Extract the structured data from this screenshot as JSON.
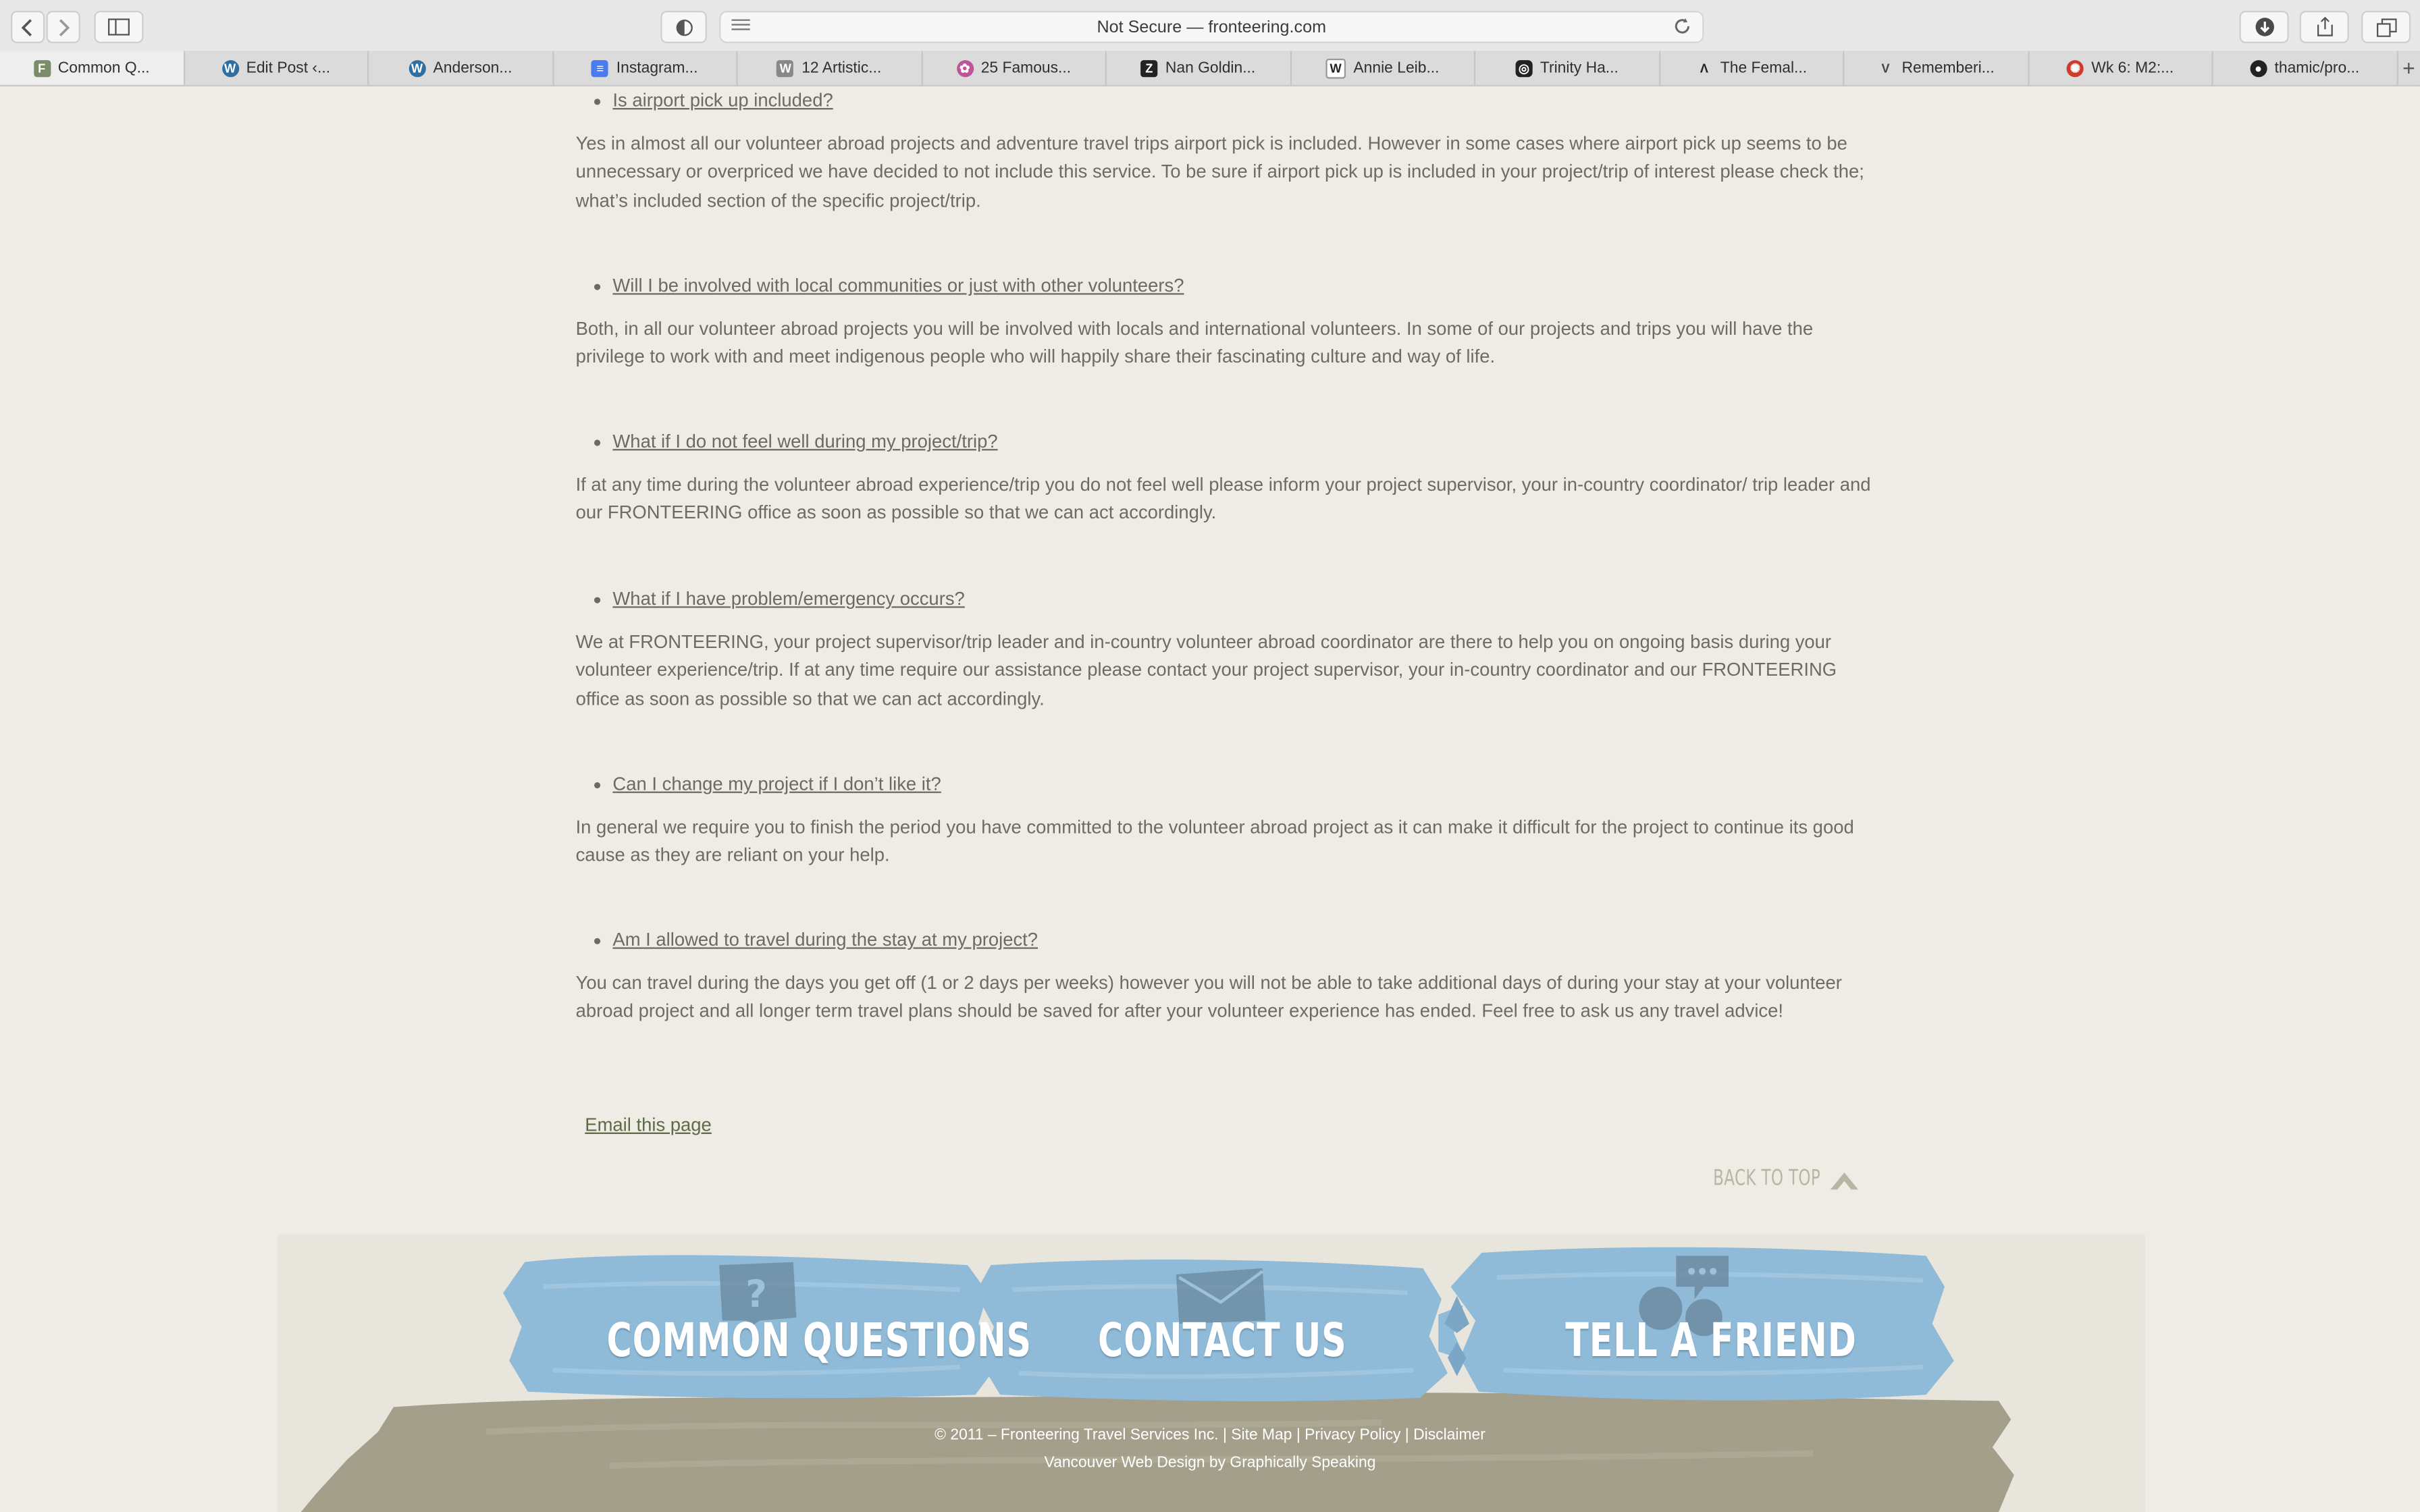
{
  "browser": {
    "address": "Not Secure — fronteering.com",
    "tabs": [
      {
        "label": "Common Q...",
        "icon": "fronteering-favicon",
        "color": "#7a8d6a"
      },
      {
        "label": "Edit Post ‹...",
        "icon": "wordpress-icon",
        "color": "#2d6fa3"
      },
      {
        "label": "Anderson...",
        "icon": "wordpress-icon",
        "color": "#2d6fa3"
      },
      {
        "label": "Instagram...",
        "icon": "google-docs-icon",
        "color": "#4a7cf0"
      },
      {
        "label": "12 Artistic...",
        "icon": "w-icon",
        "color": "#888888"
      },
      {
        "label": "25 Famous...",
        "icon": "flower-icon",
        "color": "#c0549a"
      },
      {
        "label": "Nan Goldin...",
        "icon": "z-icon",
        "color": "#222222"
      },
      {
        "label": "Annie Leib...",
        "icon": "wikipedia-icon",
        "color": "#222222"
      },
      {
        "label": "Trinity Ha...",
        "icon": "instagram-icon",
        "color": "#222222"
      },
      {
        "label": "The Femal...",
        "icon": "a-icon",
        "color": "#222222"
      },
      {
        "label": "Rememberi...",
        "icon": "v-icon",
        "color": "#444444"
      },
      {
        "label": "Wk 6: M2:...",
        "icon": "canvas-icon",
        "color": "#d0392b"
      },
      {
        "label": "thamic/pro...",
        "icon": "github-icon",
        "color": "#222222"
      }
    ]
  },
  "faq": [
    {
      "question": "Is airport pick up included?",
      "answer": "Yes in almost all our volunteer abroad projects and adventure travel trips airport pick is included. However in some cases where airport pick up seems to be unnecessary or overpriced we have decided to not include this service. To be sure if airport pick up is included in your project/trip of interest please check the; what’s included section of the specific project/trip."
    },
    {
      "question": "Will I be involved with local communities or just with other volunteers?",
      "answer": "Both, in all our volunteer abroad projects you will be involved with locals and international volunteers. In some of our projects and trips you will have the privilege to work with and meet indigenous people who will happily share their fascinating culture and way of life."
    },
    {
      "question": "What if I do not feel well during my project/trip?",
      "answer": "If at any time during the volunteer abroad experience/trip you do not feel well please inform your project supervisor, your in-country coordinator/ trip leader and our FRONTEERING office as soon as possible so that we can act accordingly."
    },
    {
      "question": "What if I have problem/emergency occurs?",
      "answer": "We at FRONTEERING, your project supervisor/trip leader and in-country volunteer abroad coordinator are there to help you on ongoing basis during your volunteer experience/trip. If at any time require our assistance please contact your project supervisor, your in-country coordinator and our FRONTEERING office as soon as possible so that we can act accordingly."
    },
    {
      "question": "Can I change my project if I don’t like it?",
      "answer": "In general we require you to finish the period you have committed to the volunteer abroad project as it can make it difficult for the project to continue its good cause as they are reliant on your help."
    },
    {
      "question": "Am I allowed to travel during the stay at my project?",
      "answer": "You can travel during the days you get off (1 or 2 days per weeks) however you will not be able to take additional days of during your stay at your volunteer abroad project and all longer term travel plans should be saved for after your volunteer experience has ended. Feel free to ask us any travel advice!"
    }
  ],
  "email_link": "Email this page",
  "back_to_top": "BACK TO TOP",
  "footer": {
    "common_questions": "COMMON QUESTIONS",
    "contact_us": "CONTACT US",
    "tell_a_friend": "TELL A FRIEND",
    "copyright": "© 2011 – Fronteering Travel Services Inc.",
    "site_map": "Site Map",
    "privacy_policy": "Privacy Policy",
    "disclaimer": "Disclaimer",
    "separator": "|",
    "credit": "Vancouver Web Design by Graphically Speaking"
  },
  "colors": {
    "background": "#eeece4",
    "brush_blue": "#8fbad8",
    "brush_tan": "#a39f8b",
    "link_green": "#5e6b47"
  }
}
